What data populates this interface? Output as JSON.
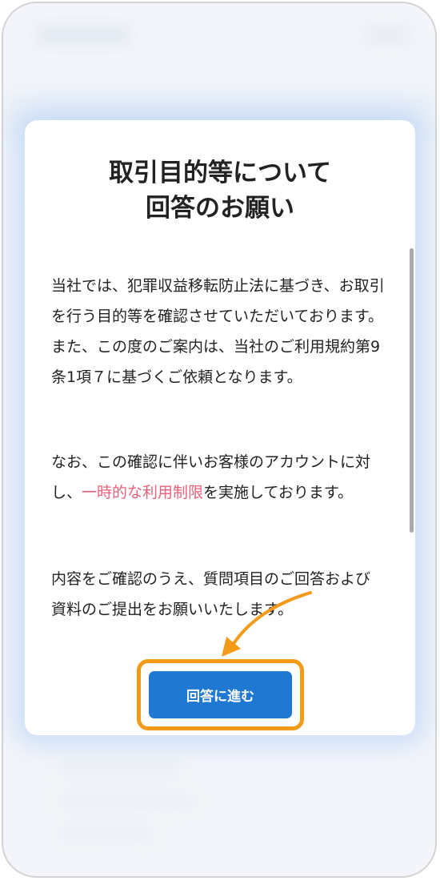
{
  "modal": {
    "title_line1": "取引目的等について",
    "title_line2": "回答のお願い",
    "p1_text": "当社では、犯罪収益移転防止法に基づき、お取引を行う目的等を確認させていただいております。また、この度のご案内は、当社のご利用規約第9条1項７に基づくご依頼となります。",
    "p2_before": "なお、この確認に伴いお客様のアカウントに対し、",
    "p2_highlight": "一時的な利用制限",
    "p2_after": "を実施しております。",
    "p3_text": "内容をご確認のうえ、質問項目のご回答および資料のご提出をお願いいたします。",
    "button_label": "回答に進む"
  },
  "colors": {
    "accent_blue": "#1f78d1",
    "highlight_orange": "#f39b18",
    "warning_pink": "#e8627a"
  }
}
